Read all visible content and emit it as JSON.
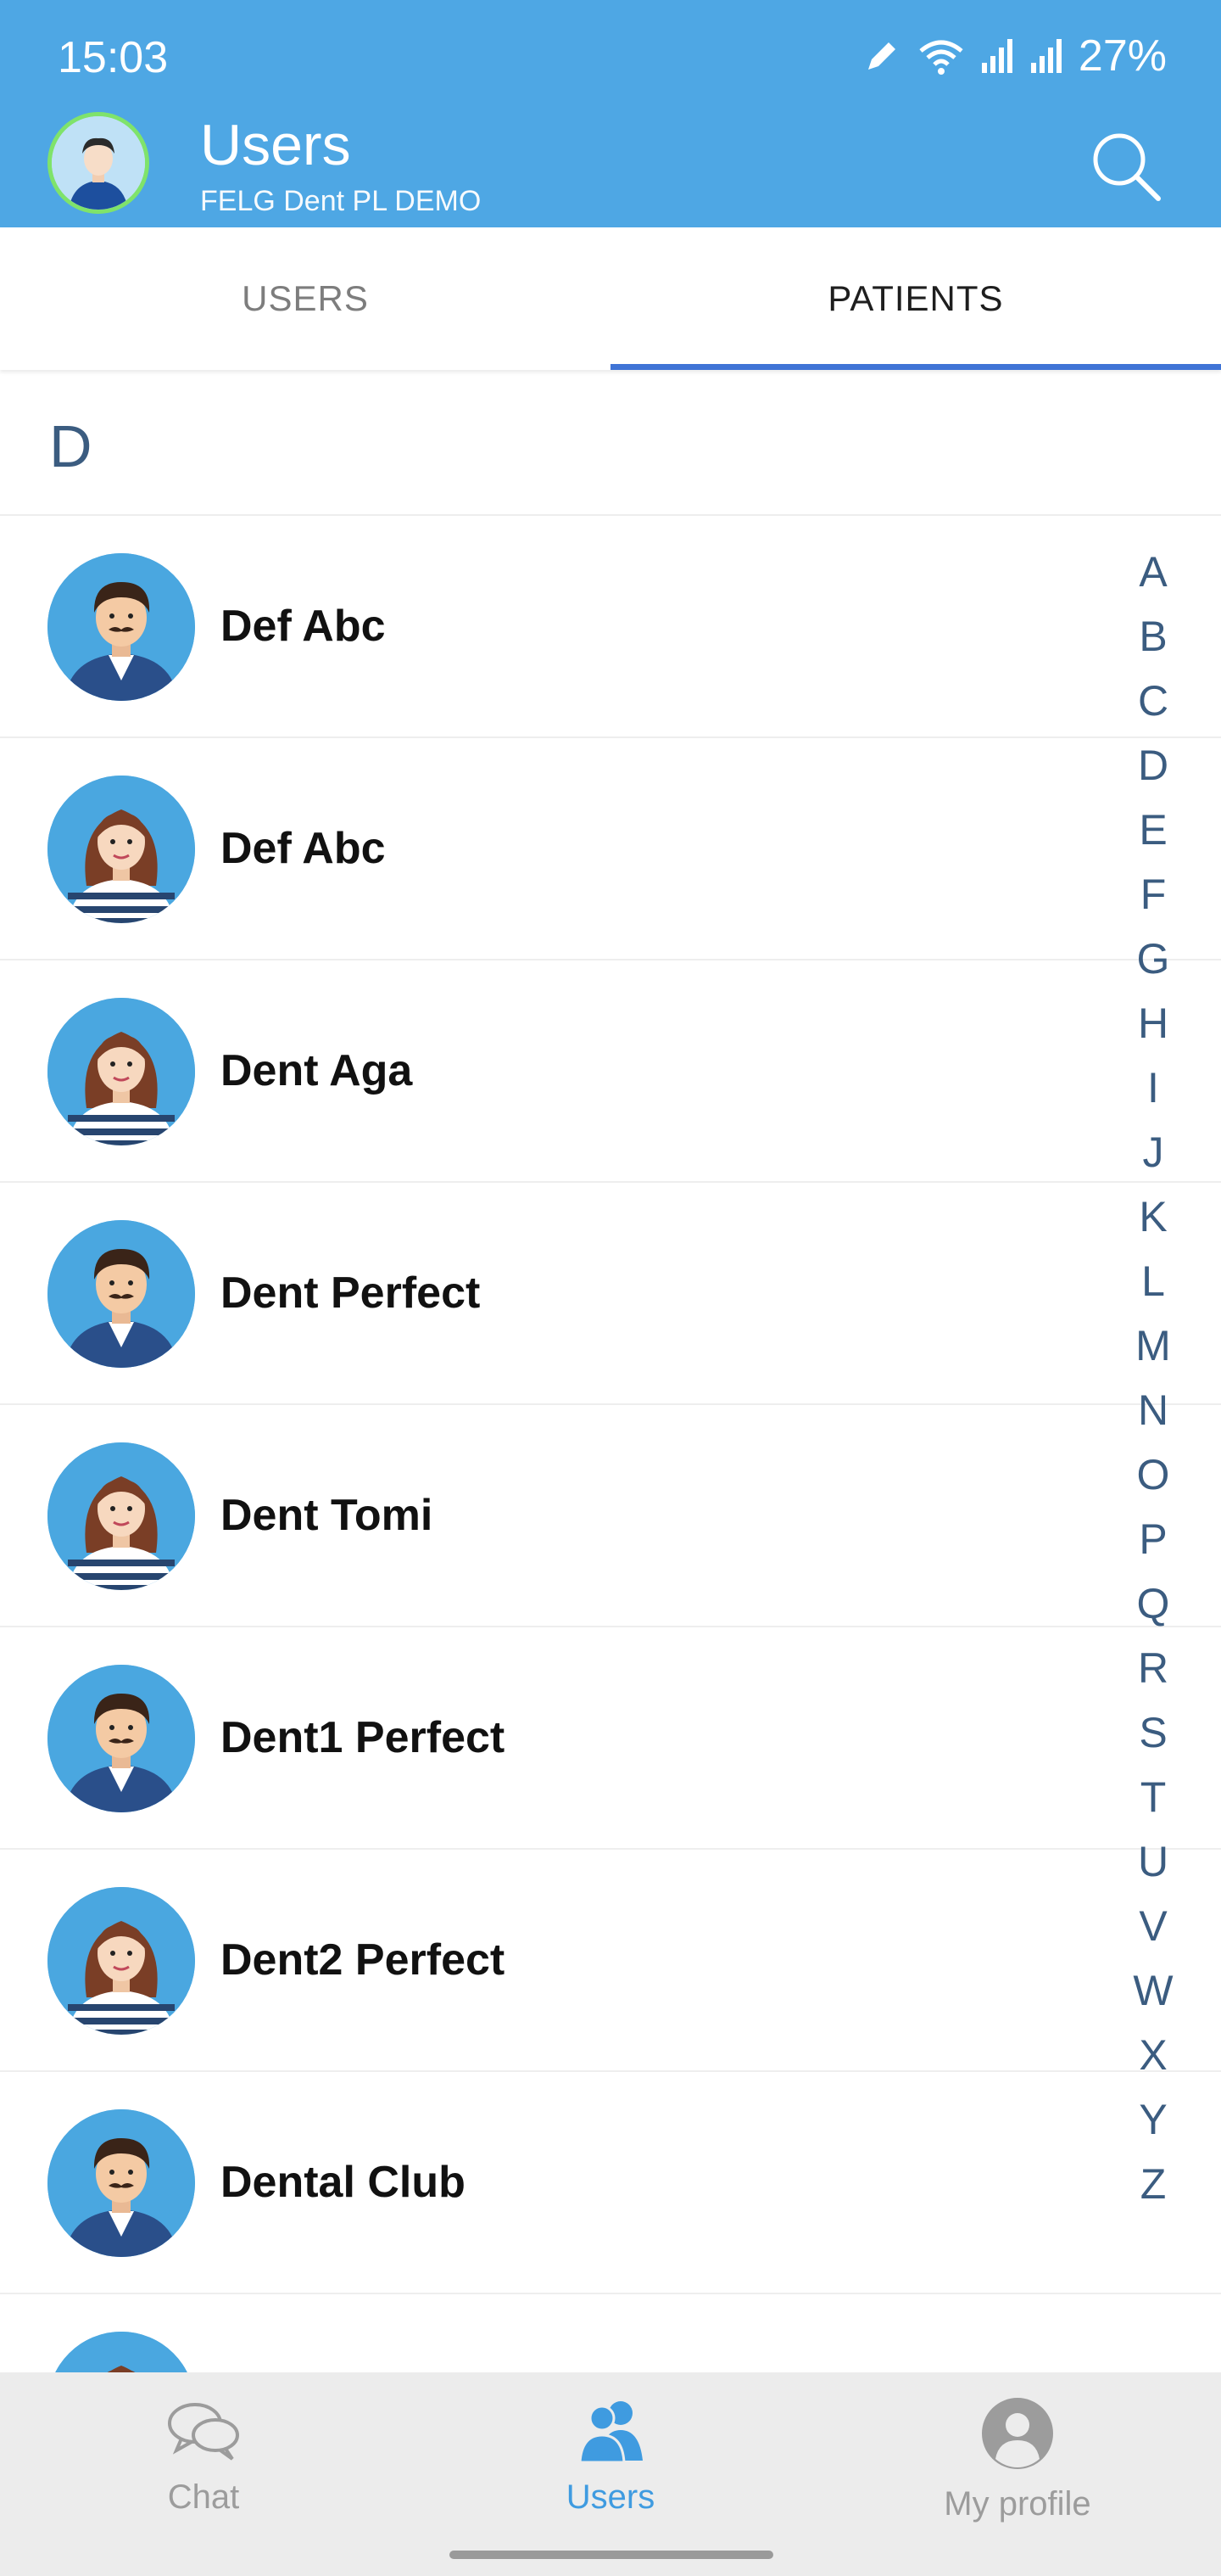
{
  "status_bar": {
    "time": "15:03",
    "battery": "27%"
  },
  "header": {
    "title": "Users",
    "subtitle": "FELG Dent PL DEMO",
    "search_icon": "search-icon"
  },
  "tabs": [
    {
      "label": "USERS",
      "active": false
    },
    {
      "label": "PATIENTS",
      "active": true
    }
  ],
  "section": {
    "letter": "D"
  },
  "patients": [
    {
      "name": "Def Abc",
      "avatar": "male-avatar"
    },
    {
      "name": "Def Abc",
      "avatar": "female-avatar"
    },
    {
      "name": "Dent Aga",
      "avatar": "female-avatar"
    },
    {
      "name": "Dent Perfect",
      "avatar": "male-avatar"
    },
    {
      "name": "Dent Tomi",
      "avatar": "female-avatar"
    },
    {
      "name": "Dent1 Perfect",
      "avatar": "male-avatar"
    },
    {
      "name": "Dent2 Perfect",
      "avatar": "female-avatar"
    },
    {
      "name": "Dental Club",
      "avatar": "male-avatar"
    },
    {
      "name": "",
      "avatar": "female-avatar"
    }
  ],
  "alphabet_index": [
    "A",
    "B",
    "C",
    "D",
    "E",
    "F",
    "G",
    "H",
    "I",
    "J",
    "K",
    "L",
    "M",
    "N",
    "O",
    "P",
    "Q",
    "R",
    "S",
    "T",
    "U",
    "V",
    "W",
    "X",
    "Y",
    "Z"
  ],
  "bottom_nav": [
    {
      "label": "Chat",
      "icon": "chat-icon",
      "active": false
    },
    {
      "label": "Users",
      "icon": "users-icon",
      "active": true
    },
    {
      "label": "My profile",
      "icon": "profile-icon",
      "active": false
    }
  ],
  "colors": {
    "header": "#4ea7e4",
    "tab_indicator": "#3f74d6",
    "nav_active": "#3f9be0",
    "index_letter": "#3b5c80"
  }
}
